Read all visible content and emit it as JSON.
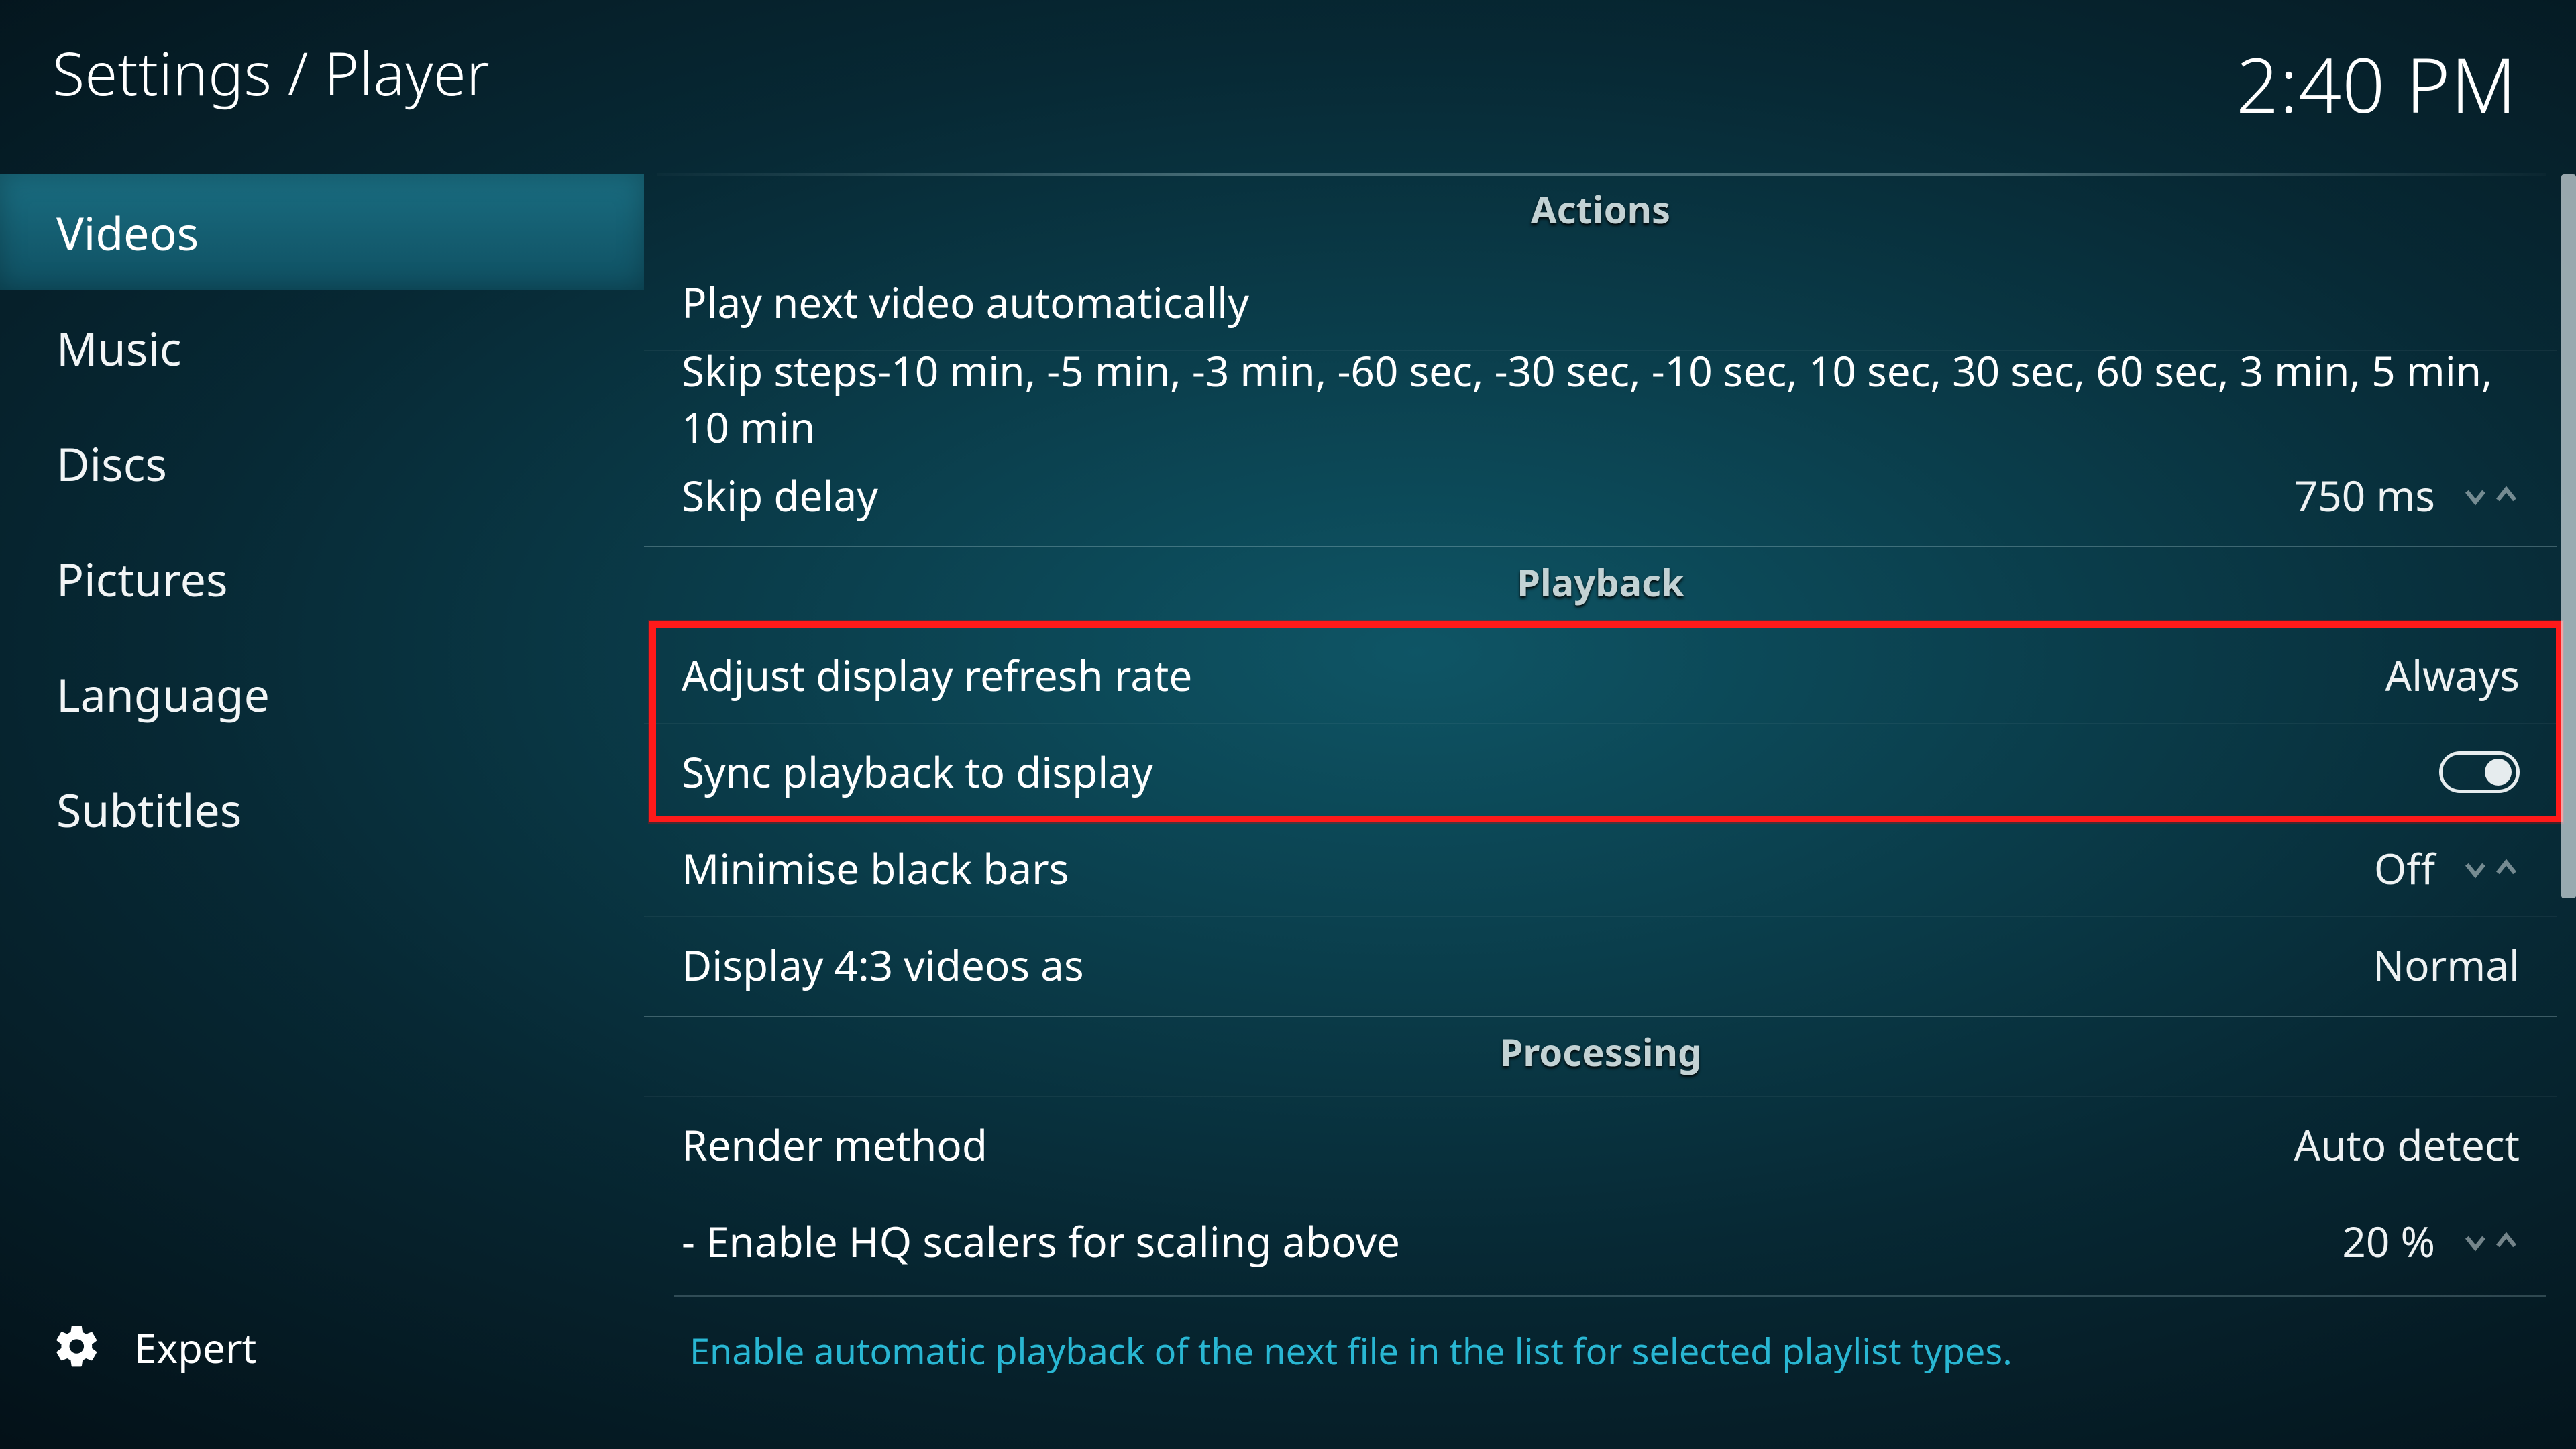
{
  "header": {
    "breadcrumb": "Settings / Player",
    "clock": "2:40 PM"
  },
  "sidebar": {
    "items": [
      {
        "label": "Videos",
        "selected": true
      },
      {
        "label": "Music",
        "selected": false
      },
      {
        "label": "Discs",
        "selected": false
      },
      {
        "label": "Pictures",
        "selected": false
      },
      {
        "label": "Language",
        "selected": false
      },
      {
        "label": "Subtitles",
        "selected": false
      }
    ]
  },
  "level": {
    "label": "Expert"
  },
  "sections": [
    {
      "title": "Actions",
      "rows": [
        {
          "key": "play-next",
          "label": "Play next video automatically",
          "value": "",
          "control": "none"
        },
        {
          "key": "skip-steps",
          "label": "Skip steps",
          "value": "-10 min, -5 min, -3 min, -60 sec, -30 sec, -10 sec, 10 sec, 30 sec, 60 sec, 3 min, 5 min, 10 min",
          "control": "inline-value"
        },
        {
          "key": "skip-delay",
          "label": "Skip delay",
          "value": "750 ms",
          "control": "spinner"
        }
      ]
    },
    {
      "title": "Playback",
      "rows": [
        {
          "key": "refresh-rate",
          "label": "Adjust display refresh rate",
          "value": "Always",
          "control": "value"
        },
        {
          "key": "sync-display",
          "label": "Sync playback to display",
          "value": "",
          "control": "toggle",
          "state": "on"
        },
        {
          "key": "black-bars",
          "label": "Minimise black bars",
          "value": "Off",
          "control": "spinner"
        },
        {
          "key": "display-43",
          "label": "Display 4:3 videos as",
          "value": "Normal",
          "control": "value"
        }
      ]
    },
    {
      "title": "Processing",
      "rows": [
        {
          "key": "render-method",
          "label": "Render method",
          "value": "Auto detect",
          "control": "value"
        },
        {
          "key": "hq-scalers",
          "label": "- Enable HQ scalers for scaling above",
          "value": "20 %",
          "control": "spinner"
        }
      ]
    }
  ],
  "hint": "Enable automatic playback of the next file in the list for selected playlist types.",
  "highlight": {
    "section_index": 1,
    "from_row": 0,
    "to_row": 1
  }
}
